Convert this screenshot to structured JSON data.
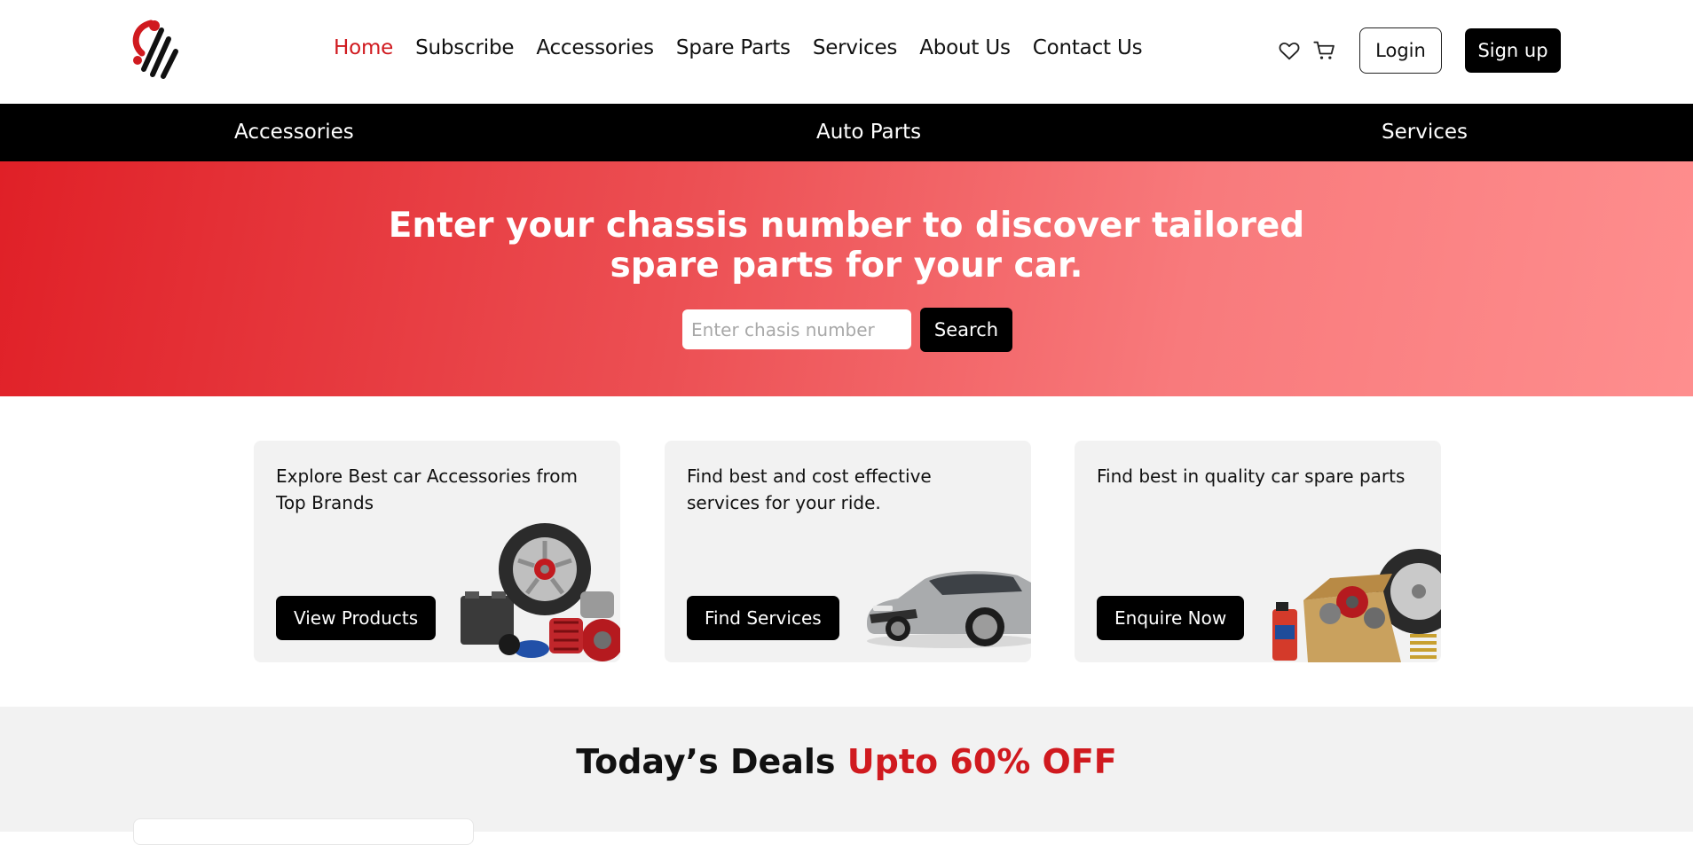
{
  "header": {
    "logo_icon": "brand-logo",
    "nav": [
      {
        "label": "Home",
        "active": true
      },
      {
        "label": "Subscribe"
      },
      {
        "label": "Accessories"
      },
      {
        "label": "Spare Parts"
      },
      {
        "label": "Services"
      },
      {
        "label": "About Us"
      },
      {
        "label": "Contact Us"
      }
    ],
    "wishlist_icon": "heart-icon",
    "cart_icon": "cart-icon",
    "login_label": "Login",
    "signup_label": "Sign up"
  },
  "category_bar": {
    "items": [
      "Accessories",
      "Auto Parts",
      "Services"
    ]
  },
  "hero": {
    "title": "Enter your chassis number to discover tailored spare parts for your car.",
    "input_placeholder": "Enter chasis number",
    "search_label": "Search"
  },
  "cards": [
    {
      "text": "Explore Best car Accessories from Top Brands",
      "button": "View Products",
      "image": "car-accessories-image"
    },
    {
      "text": "Find best and cost effective services for your ride.",
      "button": "Find Services",
      "image": "silver-car-image"
    },
    {
      "text": "Find best in quality car spare parts",
      "button": "Enquire Now",
      "image": "spare-parts-box-image"
    }
  ],
  "deals": {
    "title": "Today’s Deals",
    "highlight": "Upto 60% OFF"
  },
  "colors": {
    "accent": "#d01a1f",
    "hero_start": "#e02027",
    "hero_end": "#fe8e8e",
    "dark": "#000000",
    "card_bg": "#f2f2f2"
  }
}
